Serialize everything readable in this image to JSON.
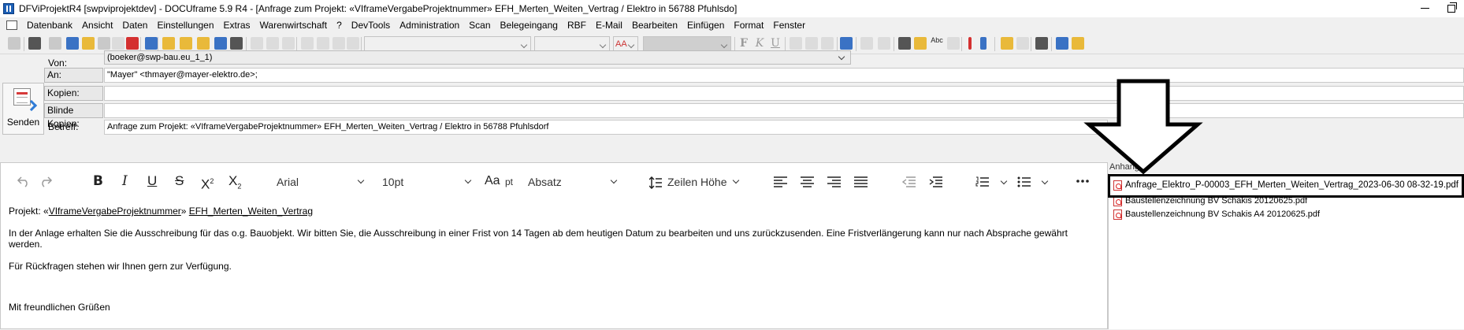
{
  "titlebar": {
    "title": "DFViProjektR4 [swpviprojektdev] - DOCUframe 5.9 R4 - [Anfrage zum Projekt: «VIframeVergabeProjektnummer» EFH_Merten_Weiten_Vertrag / Elektro in 56788 Pfuhlsdo]"
  },
  "menubar": {
    "items": [
      "Datenbank",
      "Ansicht",
      "Daten",
      "Einstellungen",
      "Extras",
      "Warenwirtschaft",
      "?",
      "DevTools",
      "Administration",
      "Scan",
      "Belegeingang",
      "RBF",
      "E-Mail",
      "Bearbeiten",
      "Einfügen",
      "Format",
      "Fenster"
    ]
  },
  "toolbar": {
    "font_icon_label": "AA",
    "abc_label": "Abc",
    "bold_label": "F",
    "italic_label": "K",
    "underline_label": "U"
  },
  "header": {
    "send_label": "Senden",
    "von_label": "Von:",
    "von_value": "(boeker@swp-bau.eu_1_1)",
    "an_label": "An:",
    "an_value": "\"Mayer\" <thmayer@mayer-elektro.de>;",
    "kopien_label": "Kopien:",
    "kopien_value": "",
    "blinde_label": "Blinde Kopien:",
    "blinde_value": "",
    "betreff_label": "Betreff:",
    "betreff_value": "Anfrage zum Projekt: «VIframeVergabeProjektnummer» EFH_Merten_Weiten_Vertrag / Elektro in 56788 Pfuhlsdorf"
  },
  "editor": {
    "font_family": "Arial",
    "font_size": "10pt",
    "size_unit": "pt",
    "paragraph_style": "Absatz",
    "line_height_label": "Zeilen Höhe",
    "body": {
      "line1_prefix": "Projekt: «",
      "line1_field": "VIframeVergabeProjektnummer",
      "line1_mid": "» ",
      "line1_project": "EFH_Merten_Weiten_Vertrag",
      "paragraph2": "In der Anlage erhalten Sie die Ausschreibung für das o.g. Bauobjekt. Wir bitten Sie, die Ausschreibung in einer Frist von 14 Tagen ab dem heutigen Datum zu bearbeiten und uns zurückzusenden. Eine Fristverlängerung kann nur nach Absprache gewährt werden.",
      "paragraph3": "Für Rückfragen stehen wir Ihnen gern zur Verfügung.",
      "closing": "Mit freundlichen Grüßen"
    }
  },
  "attachments": {
    "label": "Anhang",
    "items": [
      "Anfrage_Elektro_P-00003_EFH_Merten_Weiten_Vertrag_2023-06-30 08-32-19.pdf",
      "Baustellenzeichnung BV Schakis 20120625.pdf",
      "Baustellenzeichnung BV Schakis A4 20120625.pdf"
    ]
  },
  "colors": {
    "accent_blue": "#2f7bd6",
    "pdf_red": "#d22222",
    "highlight_border": "#000000"
  }
}
